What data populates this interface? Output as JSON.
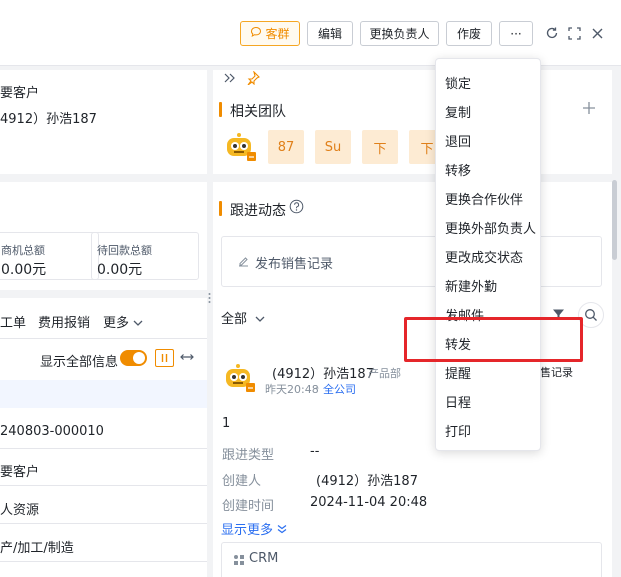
{
  "toolbar": {
    "group_label": "客群",
    "edit_label": "编辑",
    "change_owner_label": "更换负责人",
    "void_label": "作废",
    "more_label": "···"
  },
  "left": {
    "customer_level": "要客户",
    "owner": "4912）孙浩187",
    "opp_amount_label": "商机总额",
    "opp_amount_value": "0.00元",
    "tabs": [
      "工单",
      "费用报销",
      "更多"
    ],
    "show_all_label": "显示全部信息",
    "code": "240803-000010",
    "level_value": "要客户",
    "source_value": "人资源",
    "industry_value": "产/加工/制造"
  },
  "pending": {
    "label": "待回款总额",
    "value": "0.00元"
  },
  "team": {
    "title": "相关团队",
    "members": [
      "87",
      "Su",
      "下",
      "下"
    ]
  },
  "follow": {
    "title": "跟进动态",
    "publish_label": "发布销售记录",
    "filter_label": "全部",
    "record": {
      "author": "(4912）孙浩187",
      "dept": "产品部",
      "time": "昨天20:48",
      "scope": "全公司",
      "partial_label": "售记录",
      "content": "1",
      "type_label": "跟进类型",
      "type_value": "--",
      "creator_label": "创建人",
      "creator_value": "(4912）孙浩187",
      "created_label": "创建时间",
      "created_value": "2024-11-04 20:48",
      "show_more": "显示更多",
      "crm_label": "CRM"
    }
  },
  "menu": {
    "items": [
      "锁定",
      "复制",
      "退回",
      "转移",
      "更换合作伙伴",
      "更换外部负责人",
      "更改成交状态",
      "新建外勤",
      "发邮件",
      "转发",
      "提醒",
      "日程",
      "打印"
    ]
  },
  "colors": {
    "accent": "#f08c00",
    "link": "#2a6ef0",
    "highlight": "#e5262a"
  }
}
